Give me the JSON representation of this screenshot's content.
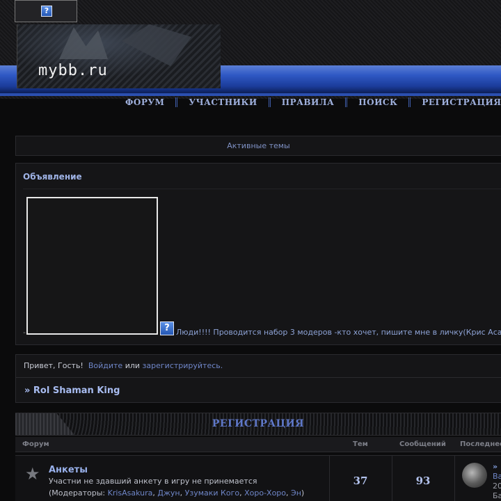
{
  "logo": {
    "text": "mybb.ru"
  },
  "top_icon": {
    "glyph": "?"
  },
  "nav": [
    "ФОРУМ",
    "УЧАСТНИКИ",
    "ПРАВИЛА",
    "ПОИСК",
    "РЕГИСТРАЦИЯ"
  ],
  "active_topics": "Активные темы",
  "announcement": {
    "title": "Объявление",
    "dash": "-",
    "icon": "?",
    "text": "Люди!!!! Проводится набор 3 модеров -кто хочет, пишите мне в личку(Крис Аса"
  },
  "guest": {
    "greeting": "Привет, Гость!",
    "login": "Войдите",
    "or": "или",
    "register": "зарегистрируйтесь."
  },
  "forum_name": "» Rol Shaman King",
  "category": {
    "title": "РЕГИСТРАЦИЯ"
  },
  "table_headers": {
    "forum": "Форум",
    "topics": "Тем",
    "posts": "Сообщений",
    "last": "Последнее"
  },
  "forums": [
    {
      "icon": "star-icon",
      "title": "Анкеты",
      "description": "Участни не здавший анкету в игру не принемается",
      "mods_prefix": "(Модераторы: ",
      "mods": [
        "KrisAsakura",
        "Джун",
        "Узумаки Кого",
        "Хоро-Хоро",
        "Эн"
      ],
      "mods_suffix": ")",
      "topics": "37",
      "posts": "93",
      "last": {
        "l1": "»",
        "l2": "Ва",
        "l3": "20",
        "l4": "Ба"
      }
    }
  ],
  "colors": {
    "accent_blue": "#2f58c4",
    "link": "#6f86c8",
    "background": "#0b0b0c"
  }
}
